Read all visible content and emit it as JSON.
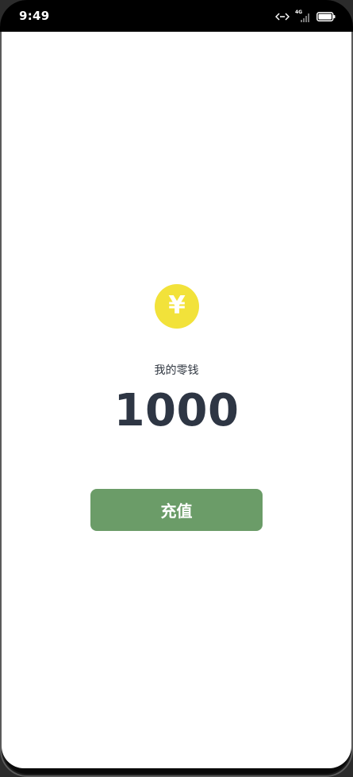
{
  "status_bar": {
    "time": "9:49",
    "network": "4G",
    "icons": [
      "data-sync-icon",
      "signal-icon",
      "battery-icon"
    ]
  },
  "wallet": {
    "icon": "yuan-coin-icon",
    "currency_symbol": "¥",
    "label": "我的零钱",
    "balance": "1000"
  },
  "actions": {
    "recharge_label": "充值"
  },
  "colors": {
    "coin": "#f2e23a",
    "button": "#6b9c68",
    "balance_text": "#2e3644"
  }
}
